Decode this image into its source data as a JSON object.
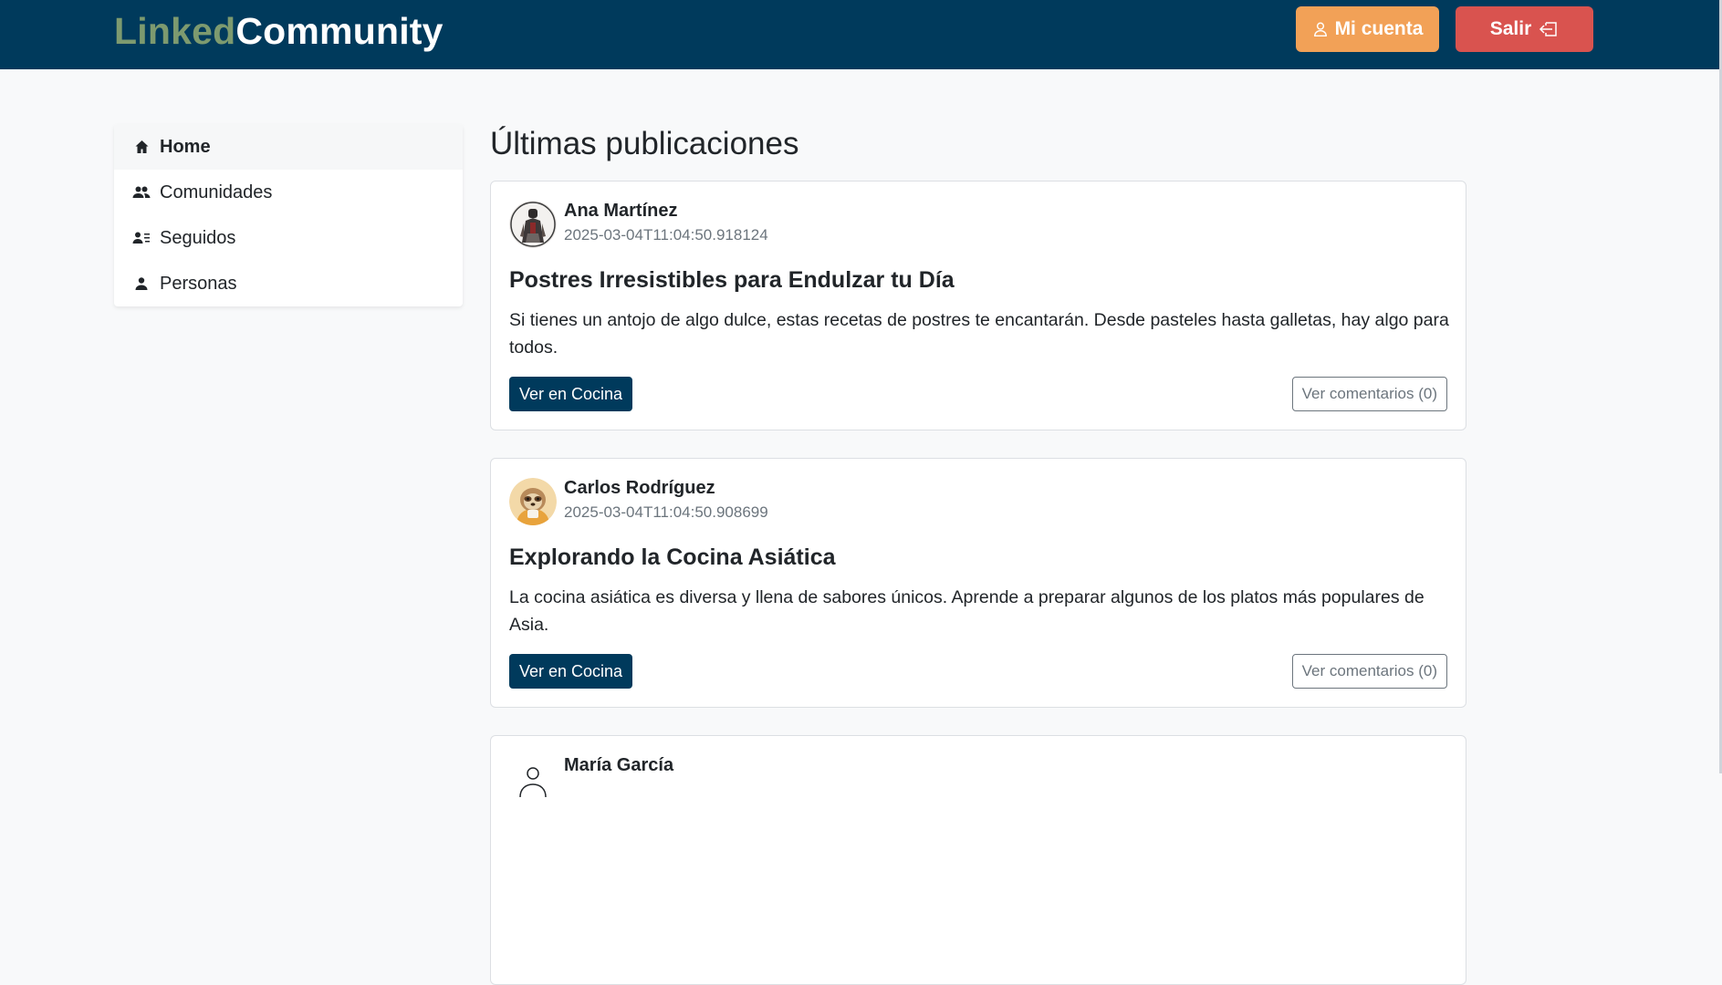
{
  "brand": {
    "part1": "Linked",
    "part2": "Community"
  },
  "header": {
    "account_label": "Mi cuenta",
    "logout_label": "Salir",
    "colors": {
      "bar": "#003a5c",
      "account": "#f2a157",
      "logout": "#d9534f"
    }
  },
  "sidebar": {
    "items": [
      {
        "label": "Home",
        "icon": "house-icon",
        "active": true
      },
      {
        "label": "Comunidades",
        "icon": "users-icon"
      },
      {
        "label": "Seguidos",
        "icon": "user-list-icon"
      },
      {
        "label": "Personas",
        "icon": "user-icon"
      }
    ]
  },
  "main": {
    "title": "Últimas publicaciones",
    "posts": [
      {
        "author": "Ana Martínez",
        "timestamp": "2025-03-04T11:04:50.918124",
        "title": "Postres Irresistibles para Endulzar tu Día",
        "body": "Si tienes un antojo de algo dulce, estas recetas de postres te encantarán. Desde pasteles hasta galletas, hay algo para todos.",
        "community_button": "Ver en Cocina",
        "comments_button": "Ver comentarios (0)"
      },
      {
        "author": "Carlos Rodríguez",
        "timestamp": "2025-03-04T11:04:50.908699",
        "title": "Explorando la Cocina Asiática",
        "body": "La cocina asiática es diversa y llena de sabores únicos. Aprende a preparar algunos de los platos más populares de Asia.",
        "community_button": "Ver en Cocina",
        "comments_button": "Ver comentarios (0)"
      },
      {
        "author": "María García"
      }
    ]
  }
}
